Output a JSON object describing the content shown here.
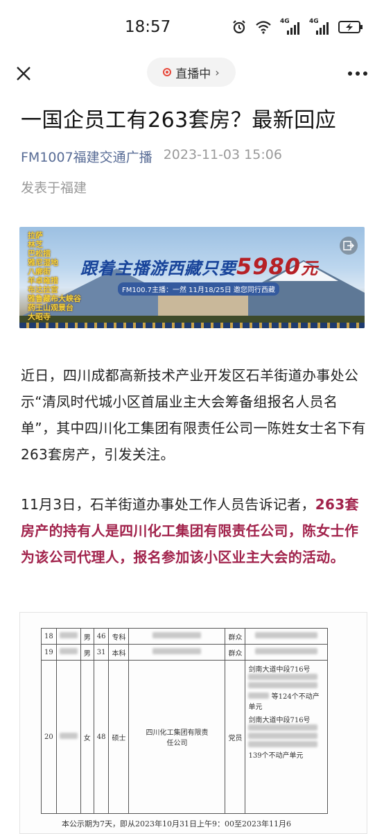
{
  "status_bar": {
    "time": "18:57",
    "icons": [
      "alarm-icon",
      "wifi-icon",
      "signal-4g-icon",
      "signal-4g-icon",
      "battery-charging-icon"
    ],
    "network_label_1": "4G",
    "network_label_2": "4G"
  },
  "nav": {
    "close_icon": "close-icon",
    "live_label": "直播中",
    "live_chevron": "›",
    "more_icon": "more-icon",
    "live_color": "#e8483a"
  },
  "article": {
    "title": "一国企员工有263套房？最新回应",
    "source": "FM1007福建交通广播",
    "date": "2023-11-03 15:06",
    "location": "发表于福建",
    "source_color": "#576b95"
  },
  "banner": {
    "places": [
      "拉萨",
      "林芝",
      "巴松措",
      "雅尼湿地",
      "八廓街",
      "羊卓雍措",
      "布达拉宫",
      "雅鲁藏布大峡谷",
      "药王山观景台",
      "大昭寺"
    ],
    "headline": "跟着主播游西藏只要",
    "price": "5980",
    "unit": "元",
    "subline": "FM100.7主播：一然 11月18/25日 邀您同行西藏",
    "share_icon": "share-icon"
  },
  "paragraphs": {
    "p1": "近日，四川成都高新技术产业开发区石羊街道办事处公示“清凤时代城小区首届业主大会筹备组报名人员名单”，其中四川化工集团有限责任公司一陈姓女士名下有263套房产，引发关注。",
    "p2_plain": "11月3日，石羊街道办事处工作人员告诉记者，",
    "p2_highlight": "263套房产的持有人是四川化工集团有限责任公司，陈女士作为该公司代理人，报名参加该小区业主大会的活动。",
    "highlight_color": "#a1224b"
  },
  "document": {
    "rows": [
      {
        "no": "18",
        "gender": "男",
        "age": "46",
        "edu": "专科",
        "party": "群众"
      },
      {
        "no": "19",
        "gender": "男",
        "age": "31",
        "edu": "本科",
        "party": "群众"
      },
      {
        "no": "20",
        "gender": "女",
        "age": "48",
        "edu": "硕士",
        "party": "党员"
      }
    ],
    "company": "四川化工集团有限责任公司",
    "address_1": "剑南大道中段716号",
    "property_count_1": "等124个不动产单元",
    "address_2": "剑南大道中段716号",
    "property_count_2": "139个不动产单元",
    "footer": "本公示期为7天，即从2023年10月31日上午9：00至2023年11月6"
  }
}
